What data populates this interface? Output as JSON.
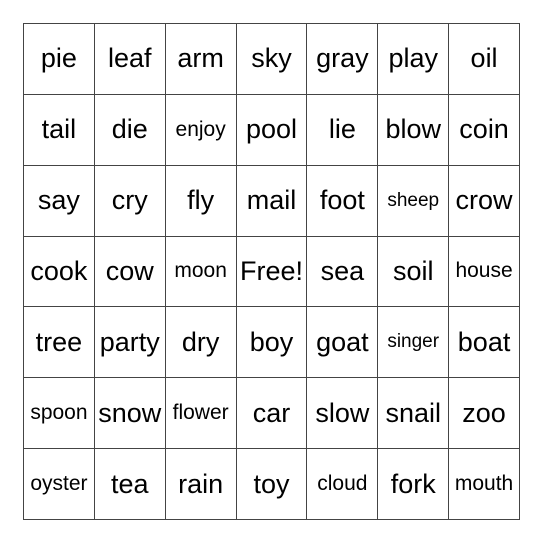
{
  "board": {
    "rows": [
      [
        "pie",
        "leaf",
        "arm",
        "sky",
        "gray",
        "play",
        "oil"
      ],
      [
        "tail",
        "die",
        "enjoy",
        "pool",
        "lie",
        "blow",
        "coin"
      ],
      [
        "say",
        "cry",
        "fly",
        "mail",
        "foot",
        "sheep",
        "crow"
      ],
      [
        "cook",
        "cow",
        "moon",
        "Free!",
        "sea",
        "soil",
        "house"
      ],
      [
        "tree",
        "party",
        "dry",
        "boy",
        "goat",
        "singer",
        "boat"
      ],
      [
        "spoon",
        "snow",
        "flower",
        "car",
        "slow",
        "snail",
        "zoo"
      ],
      [
        "oyster",
        "tea",
        "rain",
        "toy",
        "cloud",
        "fork",
        "mouth"
      ]
    ],
    "free_space": "Free!"
  }
}
